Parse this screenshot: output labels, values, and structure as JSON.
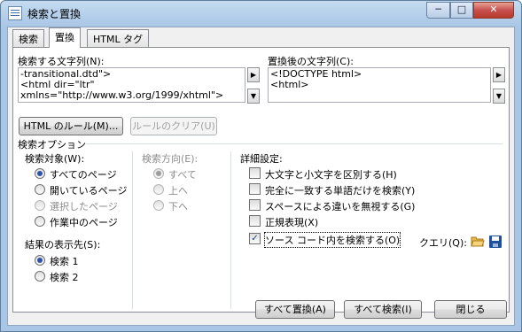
{
  "window": {
    "title": "検索と置換"
  },
  "titlebar_buttons": {
    "minimize": "─",
    "maximize": "□",
    "close": "✕"
  },
  "tabs": [
    {
      "label": "検索"
    },
    {
      "label": "置換"
    },
    {
      "label": "HTML タグ"
    }
  ],
  "find": {
    "label": "検索する文字列(N):",
    "lines": [
      "-transitional.dtd\">",
      "<html dir=\"ltr\"",
      "xmlns=\"http://www.w3.org/1999/xhtml\">"
    ]
  },
  "replace": {
    "label": "置換後の文字列(C):",
    "lines": [
      "<!DOCTYPE html>",
      "<html>"
    ]
  },
  "arrows": {
    "right": "▶",
    "down": "▼"
  },
  "buttons": {
    "html_rules": "HTML のルール(M)...",
    "clear_rules": "ルールのクリア(U)",
    "replace_all": "すべて置換(A)",
    "find_all": "すべて検索(I)",
    "close": "閉じる"
  },
  "search_options": {
    "title": "検索オプション"
  },
  "search_target": {
    "title": "検索対象(W):",
    "options": [
      "すべてのページ",
      "開いているページ",
      "選択したページ",
      "作業中のページ"
    ],
    "selected": 0
  },
  "direction": {
    "title": "検索方向(E):",
    "options": [
      "すべて",
      "上へ",
      "下へ"
    ]
  },
  "results": {
    "title": "結果の表示先(S):",
    "options": [
      "検索 1",
      "検索 2"
    ]
  },
  "advanced": {
    "title": "詳細設定:",
    "options": [
      "大文字と小文字を区別する(H)",
      "完全に一致する単語だけを検索(Y)",
      "スペースによる違いを無視する(G)",
      "正規表現(X)",
      "ソース コード内を検索する(O)"
    ],
    "checked": [
      false,
      false,
      false,
      false,
      true
    ]
  },
  "query": {
    "label": "クエリ(Q):"
  }
}
